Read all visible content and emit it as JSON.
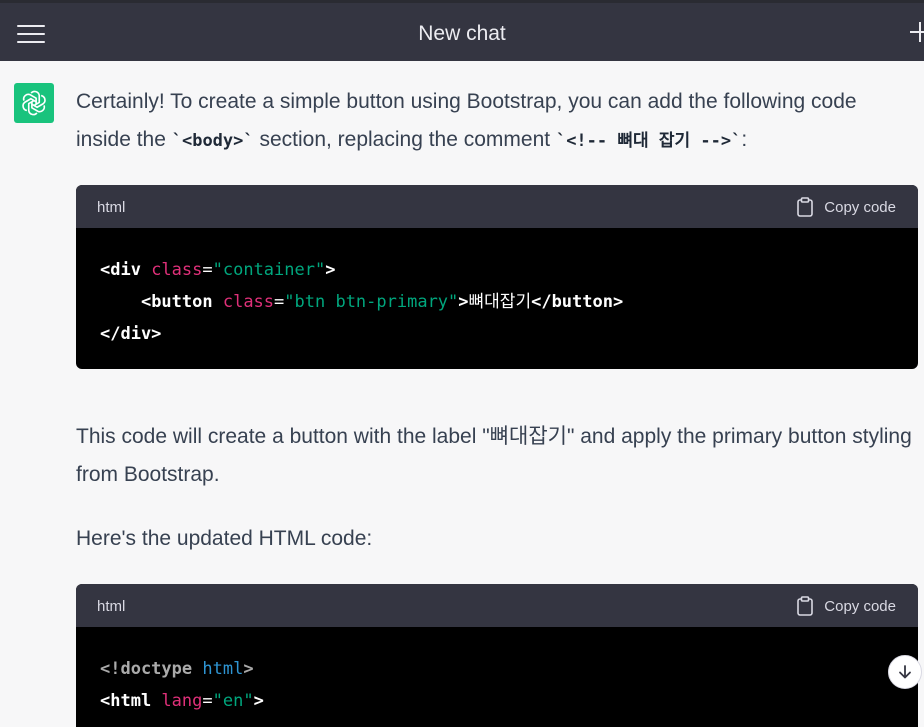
{
  "header": {
    "title": "New chat",
    "menu_icon": "hamburger-icon",
    "new_chat_icon": "plus-icon"
  },
  "message": {
    "avatar_icon": "openai-logo-icon",
    "intro_a": "Certainly! To create a simple button using Bootstrap, you can add the following code inside the ",
    "intro_code1": "`<body>`",
    "intro_b": " section, replacing the comment ",
    "intro_code2": "`<!-- 뼈대 잡기 -->`",
    "intro_c": ":",
    "explain": "This code will create a button with the label \"뼈대잡기\" and apply the primary button styling from Bootstrap.",
    "updated": "Here's the updated HTML code:"
  },
  "code1": {
    "lang": "html",
    "copy_label": "Copy code",
    "l1_open": "<div ",
    "l1_attr": "class",
    "l1_eq": "=",
    "l1_val": "\"container\"",
    "l1_close": ">",
    "l2_indent": "    ",
    "l2_open": "<button ",
    "l2_attr": "class",
    "l2_eq": "=",
    "l2_val": "\"btn btn-primary\"",
    "l2_gt": ">",
    "l2_text": "뼈대잡기",
    "l2_close": "</button>",
    "l3": "</div>"
  },
  "code2": {
    "lang": "html",
    "copy_label": "Copy code",
    "l1_doc": "<!doctype ",
    "l1_kw": "html",
    "l1_gt": ">",
    "l2_open": "<html ",
    "l2_attr": "lang",
    "l2_eq": "=",
    "l2_val": "\"en\"",
    "l2_gt": ">"
  },
  "colors": {
    "header_bg": "#343541",
    "avatar_bg": "#19c37d",
    "attr": "#df3079",
    "string": "#00a67d",
    "keyword": "#2e95d3"
  },
  "scroll_icon": "arrow-down-icon"
}
